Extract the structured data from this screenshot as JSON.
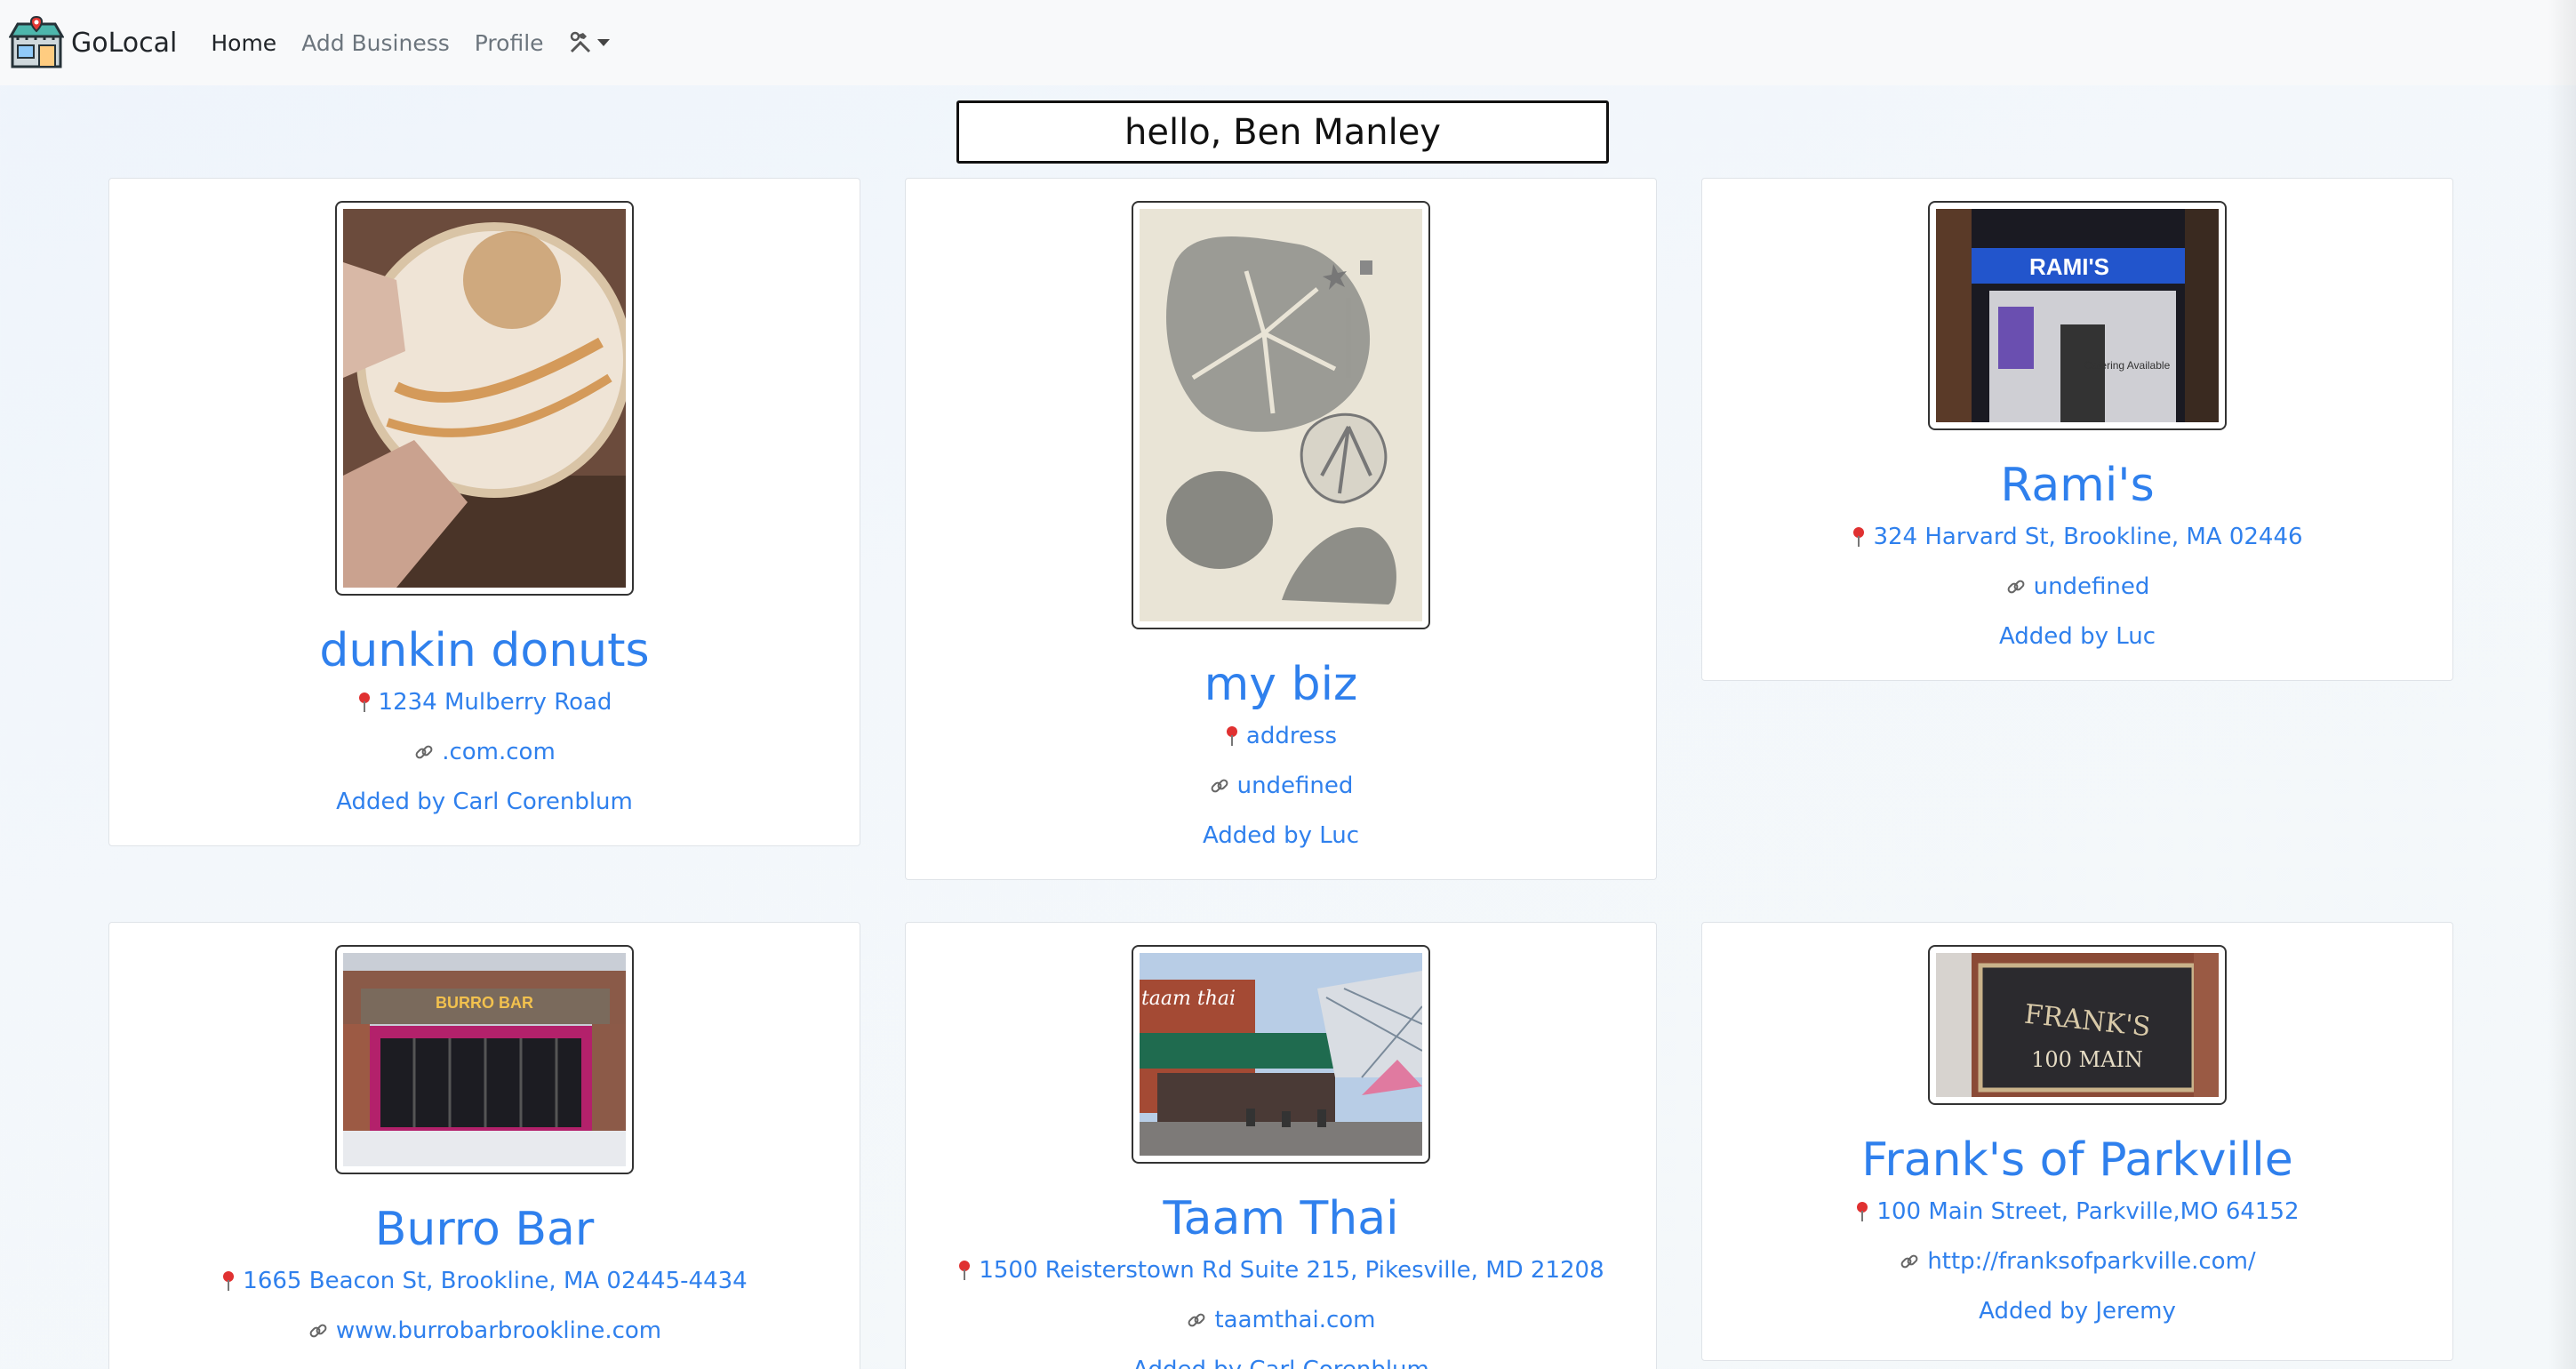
{
  "navbar": {
    "brand": "GoLocal",
    "links": [
      {
        "label": "Home",
        "active": true
      },
      {
        "label": "Add Business",
        "active": false
      },
      {
        "label": "Profile",
        "active": false
      }
    ],
    "tools_icon": "hammer-wrench-icon"
  },
  "greeting": "hello, Ben Manley",
  "businesses": [
    {
      "name": "dunkin donuts",
      "address": "1234 Mulberry Road",
      "website": ".com.com",
      "added_by": "Added by Carl Corenblum",
      "image": "glazed-donut-photo"
    },
    {
      "name": "my biz",
      "address": "address",
      "website": "undefined",
      "added_by": "Added by Luc",
      "image": "sand-dollar-engraving"
    },
    {
      "name": "Rami's",
      "address": "324 Harvard St, Brookline, MA 02446",
      "website": "undefined",
      "added_by": "Added by Luc",
      "image": "ramis-storefront-photo",
      "sign_text": "RAMI'S",
      "sign_subtext": "Catering Available"
    },
    {
      "name": "Burro Bar",
      "address": "1665 Beacon St, Brookline, MA 02445-4434",
      "website": "www.burrobarbrookline.com",
      "added_by": "",
      "image": "burro-bar-storefront-photo",
      "sign_text": "BURRO BAR"
    },
    {
      "name": "Taam Thai",
      "address": "1500 Reisterstown Rd Suite 215, Pikesville, MD 21208",
      "website": "taamthai.com",
      "added_by": "Added by Carl Corenblum",
      "image": "taam-thai-patio-photo",
      "sign_text": "taam thai"
    },
    {
      "name": "Frank's of Parkville",
      "address": "100 Main Street, Parkville,MO 64152",
      "website": "http://franksofparkville.com/",
      "added_by": "Added by Jeremy",
      "image": "franks-window-sign-photo",
      "sign_text": "FRANK'S",
      "sign_subtext": "100 MAIN"
    }
  ],
  "colors": {
    "link": "#2f80ed",
    "pin": "#e03131",
    "navbar_bg": "#f8f9fa"
  }
}
